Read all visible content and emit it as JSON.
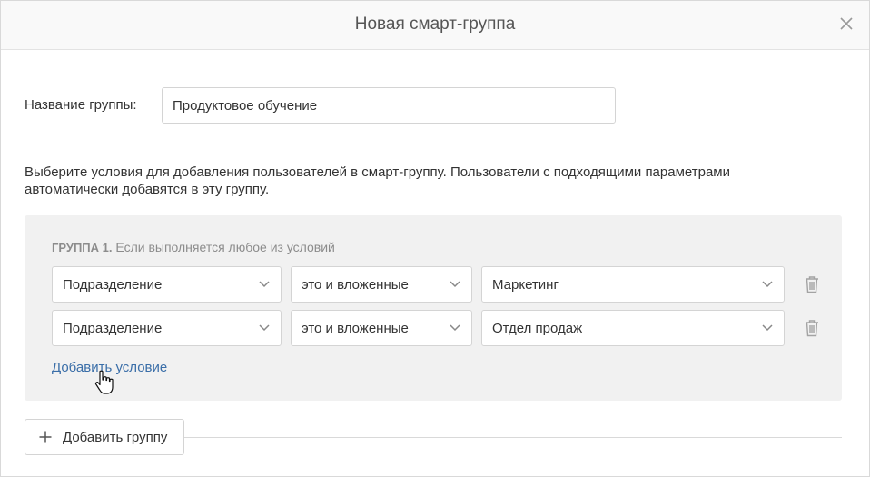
{
  "dialog": {
    "title": "Новая смарт-группа",
    "close_icon": "close-icon"
  },
  "form": {
    "name_label": "Название группы:",
    "name_value": "Продуктовое обучение",
    "description": "Выберите условия для добавления пользователей в смарт-группу. Пользователи с подходящими параметрами автоматически добавятся в эту группу."
  },
  "group": {
    "number": "ГРУППА 1.",
    "rule": "Если выполняется любое из условий",
    "conditions": [
      {
        "field": "Подразделение",
        "operator": "это и вложенные",
        "value": "Маркетинг"
      },
      {
        "field": "Подразделение",
        "operator": "это и вложенные",
        "value": "Отдел продаж"
      }
    ],
    "add_condition_label": "Добавить условие"
  },
  "footer": {
    "add_group_label": "Добавить группу"
  },
  "colors": {
    "link": "#3a6ea8",
    "panel_bg": "#f1f1f1",
    "border": "#d4d4d4"
  }
}
